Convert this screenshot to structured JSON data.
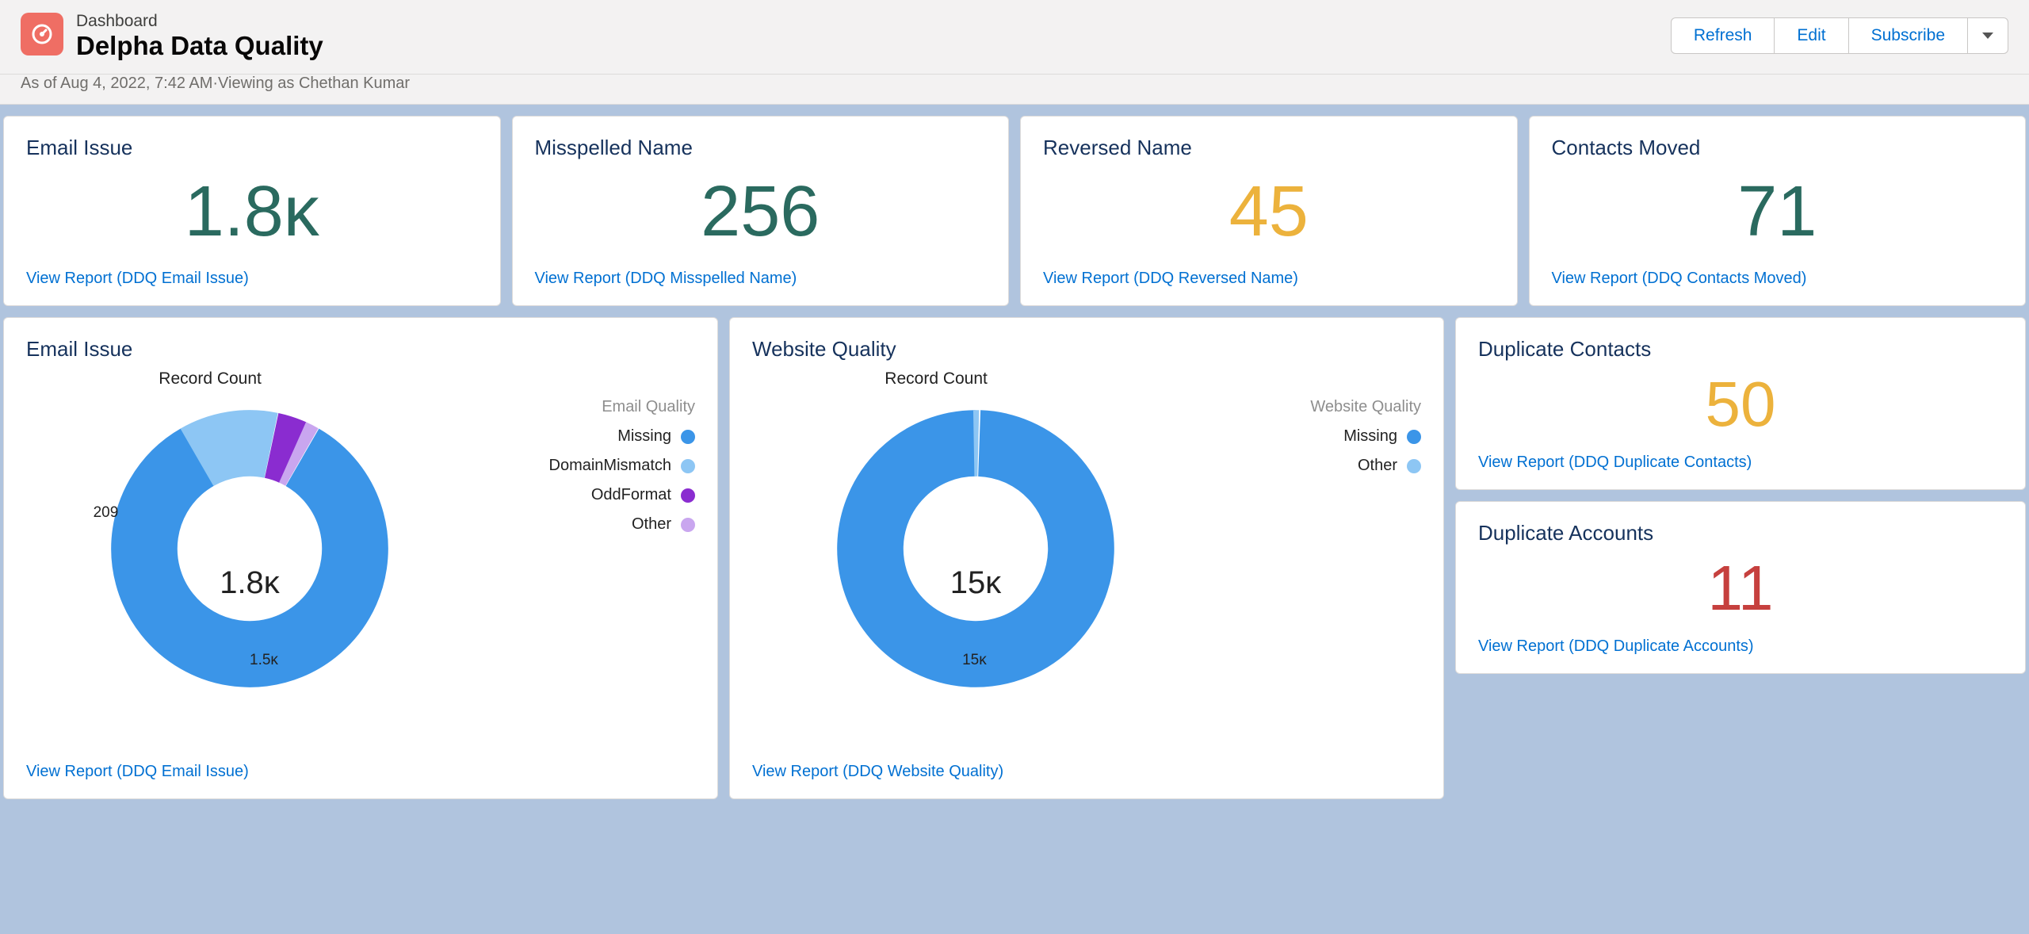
{
  "header": {
    "breadcrumb": "Dashboard",
    "title": "Delpha Data Quality",
    "meta": "As of Aug 4, 2022, 7:42 AM·Viewing as Chethan Kumar",
    "refresh_label": "Refresh",
    "edit_label": "Edit",
    "subscribe_label": "Subscribe"
  },
  "metric_tiles": [
    {
      "title": "Email Issue",
      "value": "1.8ᴋ",
      "color": "teal",
      "report": "View Report (DDQ Email Issue)"
    },
    {
      "title": "Misspelled Name",
      "value": "256",
      "color": "teal",
      "report": "View Report (DDQ Misspelled Name)"
    },
    {
      "title": "Reversed Name",
      "value": "45",
      "color": "amber",
      "report": "View Report (DDQ Reversed Name)"
    },
    {
      "title": "Contacts Moved",
      "value": "71",
      "color": "teal",
      "report": "View Report (DDQ Contacts Moved)"
    }
  ],
  "donut_email": {
    "title": "Email Issue",
    "top_label": "Record Count",
    "center": "1.8ᴋ",
    "legend_title": "Email Quality",
    "legend": [
      {
        "label": "Missing",
        "color": "#3b95e8"
      },
      {
        "label": "DomainMismatch",
        "color": "#8dc6f4"
      },
      {
        "label": "OddFormat",
        "color": "#8a2cd0"
      },
      {
        "label": "Other",
        "color": "#c9a6ef"
      }
    ],
    "seg_labels": {
      "big": "1.5ᴋ",
      "small": "209"
    },
    "report": "View Report (DDQ Email Issue)"
  },
  "donut_website": {
    "title": "Website Quality",
    "top_label": "Record Count",
    "center": "15ᴋ",
    "legend_title": "Website Quality",
    "legend": [
      {
        "label": "Missing",
        "color": "#3b95e8"
      },
      {
        "label": "Other",
        "color": "#8dc6f4"
      }
    ],
    "seg_labels": {
      "big": "15ᴋ"
    },
    "report": "View Report (DDQ Website Quality)"
  },
  "dup_contacts": {
    "title": "Duplicate Contacts",
    "value": "50",
    "color": "amber",
    "report": "View Report (DDQ Duplicate Contacts)"
  },
  "dup_accounts": {
    "title": "Duplicate Accounts",
    "value": "11",
    "color": "red",
    "report": "View Report (DDQ Duplicate Accounts)"
  },
  "chart_data": [
    {
      "type": "pie",
      "title": "Email Issue — Record Count",
      "total_label": "1.8ᴋ",
      "series": [
        {
          "name": "Missing",
          "value": 1500,
          "color": "#3b95e8"
        },
        {
          "name": "DomainMismatch",
          "value": 209,
          "color": "#8dc6f4"
        },
        {
          "name": "OddFormat",
          "value": 60,
          "color": "#8a2cd0"
        },
        {
          "name": "Other",
          "value": 30,
          "color": "#c9a6ef"
        }
      ],
      "legend_title": "Email Quality"
    },
    {
      "type": "pie",
      "title": "Website Quality — Record Count",
      "total_label": "15ᴋ",
      "series": [
        {
          "name": "Missing",
          "value": 14900,
          "color": "#3b95e8"
        },
        {
          "name": "Other",
          "value": 100,
          "color": "#8dc6f4"
        }
      ],
      "legend_title": "Website Quality"
    }
  ]
}
